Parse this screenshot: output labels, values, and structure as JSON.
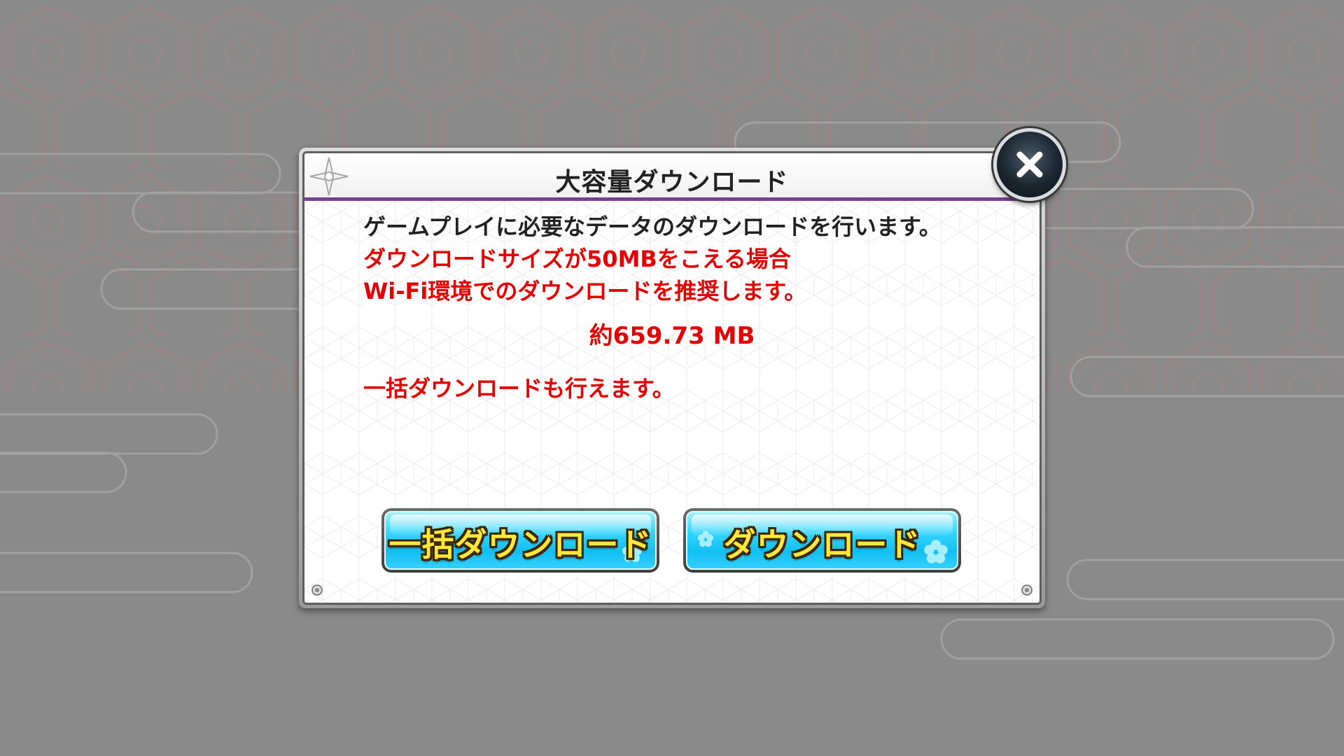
{
  "dialog": {
    "title": "大容量ダウンロード",
    "message_line1": "ゲームプレイに必要なデータのダウンロードを行います。",
    "message_line2": "ダウンロードサイズが50MBをこえる場合",
    "message_line3": "Wi-Fi環境でのダウンロードを推奨します。",
    "download_size": "約659.73 MB",
    "bulk_note": "一括ダウンロードも行えます。"
  },
  "buttons": {
    "bulk_download_label": "一括ダウンロード",
    "download_label": "ダウンロード"
  },
  "icons": {
    "close": "close-icon",
    "title_ornament": "shuriken-icon",
    "button_decoration": "sakura-icon"
  },
  "colors": {
    "title_underline": "#7c3f93",
    "warning_text": "#e30000",
    "button_face": "#12bff1",
    "button_label": "#ffe83a"
  }
}
